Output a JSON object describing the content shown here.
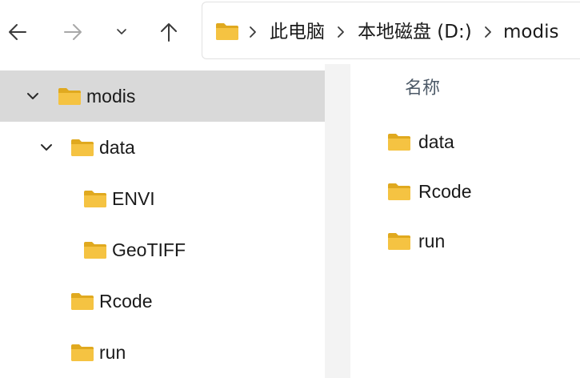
{
  "toolbar": {
    "back_icon": "arrow-left-icon",
    "forward_icon": "arrow-right-icon",
    "recent_icon": "chevron-down-icon",
    "up_icon": "arrow-up-icon"
  },
  "address_bar": {
    "breadcrumbs": [
      "此电脑",
      "本地磁盘 (D:)",
      "modis"
    ]
  },
  "tree": [
    {
      "label": "modis",
      "expanded": true,
      "selected": true
    },
    {
      "label": "data",
      "expanded": true
    },
    {
      "label": "ENVI"
    },
    {
      "label": "GeoTIFF"
    },
    {
      "label": "Rcode"
    },
    {
      "label": "run"
    }
  ],
  "content": {
    "column_name": "名称",
    "items": [
      "data",
      "Rcode",
      "run"
    ]
  },
  "colors": {
    "folder": "#f5c342",
    "folder_tab": "#e0a91f",
    "selected_row": "#d9d9d9"
  }
}
